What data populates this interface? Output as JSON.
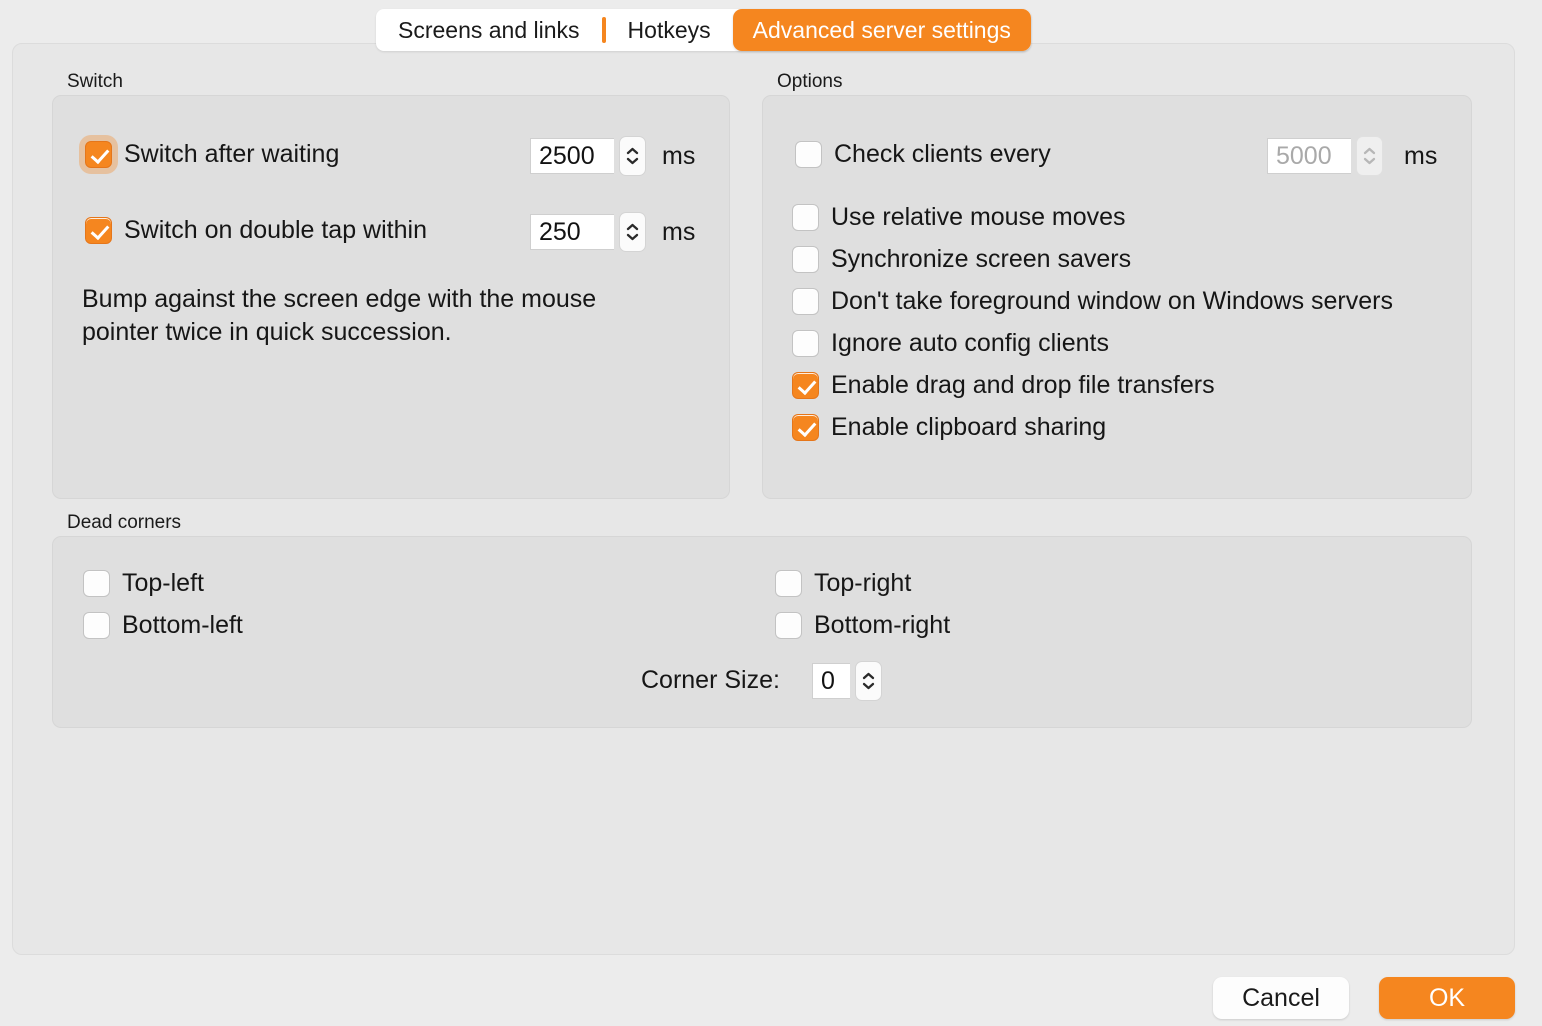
{
  "tabs": [
    {
      "label": "Screens and links",
      "active": false
    },
    {
      "label": "Hotkeys",
      "active": false
    },
    {
      "label": "Advanced server settings",
      "active": true
    }
  ],
  "colors": {
    "accent": "#f5861f",
    "window_bg": "#ececec",
    "pane_bg": "#e7e7e7",
    "group_bg": "#dfdfdf"
  },
  "switch_group": {
    "title": "Switch",
    "switch_after_waiting": {
      "label": "Switch after waiting",
      "checked": true,
      "focused": true,
      "value": "2500",
      "unit": "ms"
    },
    "switch_on_double_tap": {
      "label": "Switch on double tap within",
      "checked": true,
      "focused": false,
      "value": "250",
      "unit": "ms"
    },
    "hint": "Bump against the screen edge with the mouse\npointer twice in quick succession."
  },
  "options_group": {
    "title": "Options",
    "check_clients_every": {
      "label": "Check clients every",
      "checked": false,
      "value": "5000",
      "unit": "ms",
      "disabled": true
    },
    "items": [
      {
        "label": "Use relative mouse moves",
        "checked": false
      },
      {
        "label": "Synchronize screen savers",
        "checked": false
      },
      {
        "label": "Don't take foreground window on Windows servers",
        "checked": false
      },
      {
        "label": "Ignore auto config clients",
        "checked": false
      },
      {
        "label": "Enable drag and drop file transfers",
        "checked": true
      },
      {
        "label": "Enable clipboard sharing",
        "checked": true
      }
    ]
  },
  "dead_corners_group": {
    "title": "Dead corners",
    "top_left": {
      "label": "Top-left",
      "checked": false
    },
    "bottom_left": {
      "label": "Bottom-left",
      "checked": false
    },
    "top_right": {
      "label": "Top-right",
      "checked": false
    },
    "bottom_right": {
      "label": "Bottom-right",
      "checked": false
    },
    "corner_size": {
      "label": "Corner Size:",
      "value": "0"
    }
  },
  "footer": {
    "cancel_label": "Cancel",
    "ok_label": "OK"
  }
}
